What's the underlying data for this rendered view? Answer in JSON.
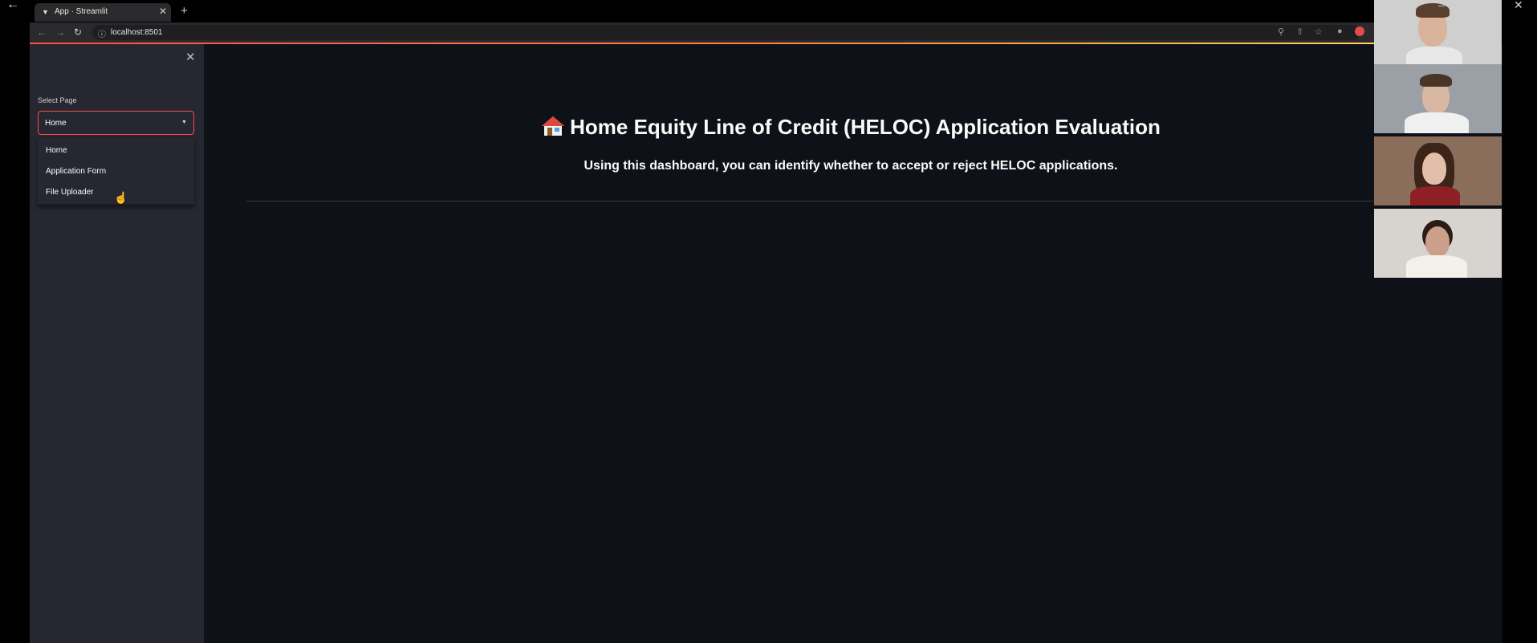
{
  "browser": {
    "tab_title": "App · Streamlit",
    "url": "localhost:8501"
  },
  "sidebar": {
    "select_label": "Select Page",
    "select_value": "Home",
    "options": [
      "Home",
      "Application Form",
      "File Uploader"
    ]
  },
  "main": {
    "title": "Home Equity Line of Credit (HELOC) Application Evaluation",
    "subtitle": "Using this dashboard, you can identify whether to accept or reject HELOC applications."
  },
  "colors": {
    "accent": "#ff4b4b",
    "app_background": "#0e1117",
    "sidebar_background": "#262730"
  },
  "icons": [
    "back-arrow-icon",
    "streamlit-favicon-icon",
    "close-icon",
    "plus-icon",
    "forward-arrow-icon",
    "reload-icon",
    "info-icon",
    "zoom-icon",
    "share-icon",
    "star-icon",
    "extension-icon",
    "caret-down-icon",
    "house-icon",
    "cursor-icon",
    "minimize-icon",
    "restore-icon"
  ]
}
